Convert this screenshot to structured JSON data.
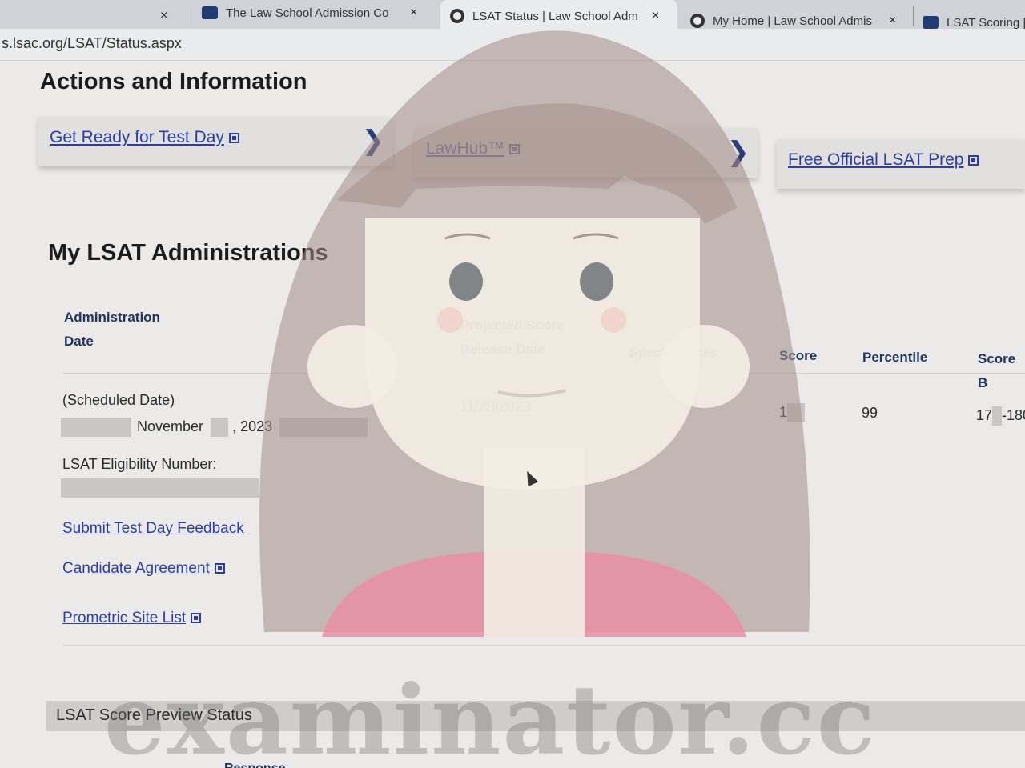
{
  "browser": {
    "tabs": [
      {
        "title": "The Law School Admission Co",
        "active": false,
        "icon": "lsac-favicon"
      },
      {
        "title": "LSAT Status | Law School Adm",
        "active": true,
        "icon": "globe-icon"
      },
      {
        "title": "My Home | Law School Admis",
        "active": false,
        "icon": "globe-icon"
      },
      {
        "title": "LSAT Scoring |",
        "active": false,
        "icon": "lsac-favicon"
      }
    ],
    "close_glyph": "×",
    "url": "s.lsac.org/LSAT/Status.aspx"
  },
  "actions": {
    "heading": "Actions and Information",
    "cards": [
      {
        "label": "Get Ready for Test Day"
      },
      {
        "label": "LawHub™"
      },
      {
        "label": "Free Official LSAT Prep"
      }
    ],
    "chevron": "❯"
  },
  "administrations": {
    "heading": "My LSAT Administrations",
    "headers": {
      "admin_date_line1": "Administration",
      "admin_date_line2": "Date",
      "release_line1": "Projected Score",
      "release_line2": "Release Date",
      "notes": "Special Notes",
      "score": "Score",
      "percentile": "Percentile",
      "band": "Score B"
    },
    "row": {
      "scheduled": "(Scheduled Date)",
      "month": "November",
      "year": ", 2023",
      "release_date": "11/29/2023",
      "score": "1",
      "percentile": "99",
      "band_start": "17",
      "band_end": "-180"
    },
    "eligibility_label": "LSAT Eligibility Number:",
    "links": [
      {
        "label": "Submit Test Day Feedback",
        "external": false
      },
      {
        "label": "Candidate Agreement",
        "external": true
      },
      {
        "label": "Prometric Site List",
        "external": true
      }
    ]
  },
  "preview": {
    "title": "LSAT Score Preview Status",
    "response_label": "Response"
  },
  "watermark": "examinator.cc",
  "colors": {
    "link": "#2a3fa0",
    "header": "#1f3461",
    "overlay_skin": "#f3ede3",
    "overlay_hair": "#a38c86",
    "overlay_shirt": "#e98ea2"
  }
}
